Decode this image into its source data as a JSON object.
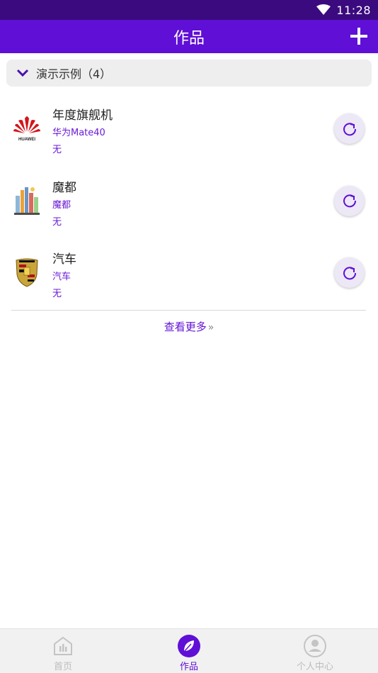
{
  "status_bar": {
    "time": "11:28"
  },
  "app_bar": {
    "title": "作品",
    "add_icon": "plus-icon"
  },
  "group": {
    "label": "演示示例（4）",
    "icon": "chevron-down-icon"
  },
  "items": [
    {
      "title": "年度旗舰机",
      "subtitle": "华为Mate40",
      "note": "无",
      "thumb": "huawei-logo"
    },
    {
      "title": "魔都",
      "subtitle": "魔都",
      "note": "无",
      "thumb": "city-illustration"
    },
    {
      "title": "汽车",
      "subtitle": "汽车",
      "note": "无",
      "thumb": "porsche-crest"
    }
  ],
  "logo_text": {
    "huawei": "HUAWEI"
  },
  "see_more": {
    "label": "查看更多",
    "arrows": "»"
  },
  "bottom_nav": [
    {
      "label": "首页",
      "icon": "home-chart-icon",
      "active": false
    },
    {
      "label": "作品",
      "icon": "leaf-icon",
      "active": true
    },
    {
      "label": "个人中心",
      "icon": "person-icon",
      "active": false
    }
  ],
  "colors": {
    "status_bar": "#3a0a7e",
    "app_bar": "#5f0fd6",
    "accent": "#6a1bd6",
    "inactive": "#bdbdbd"
  }
}
